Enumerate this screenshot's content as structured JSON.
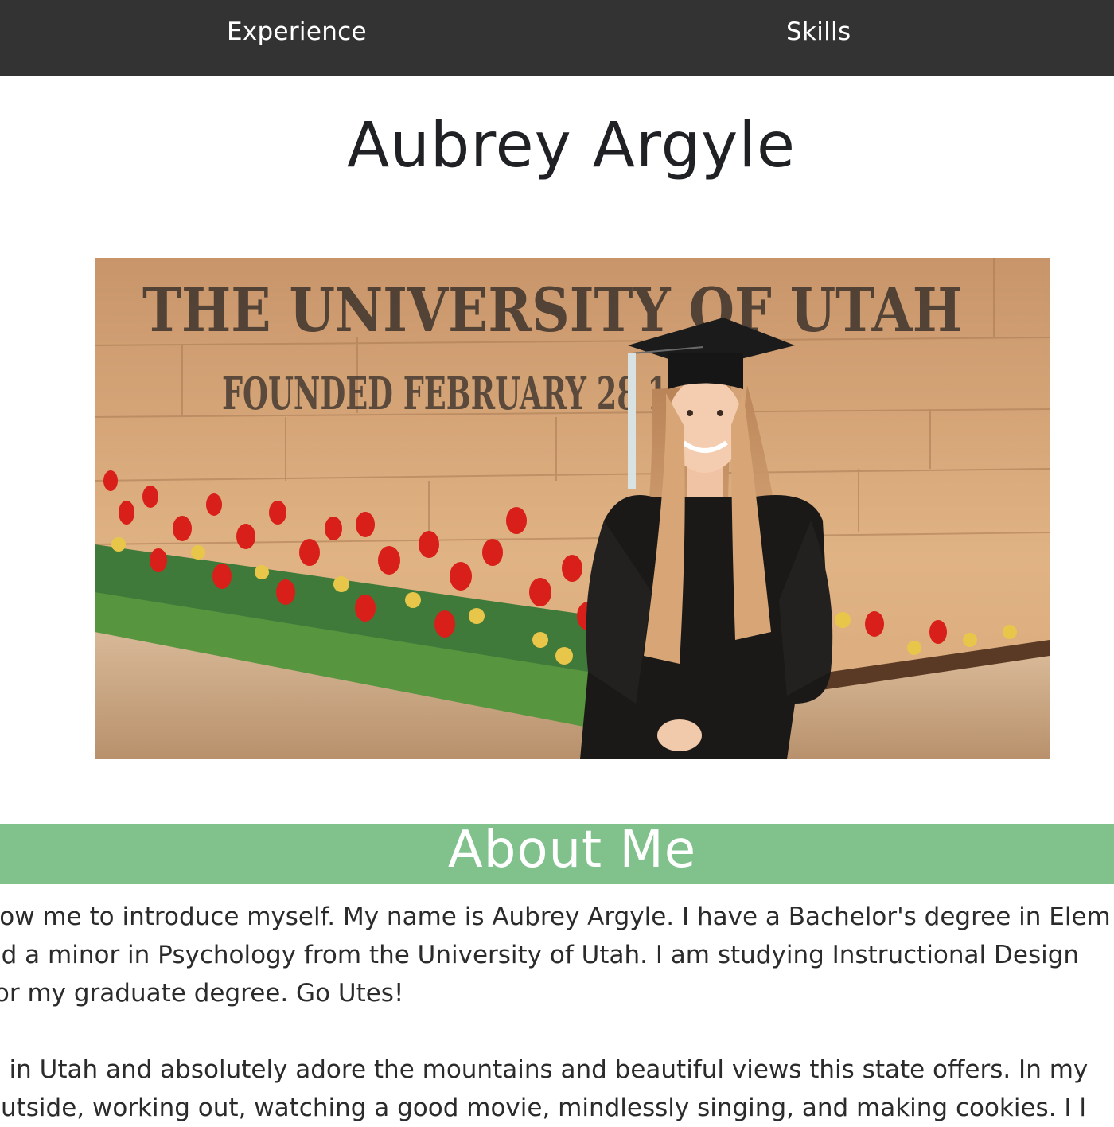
{
  "nav": {
    "experience": "Experience",
    "skills": "Skills"
  },
  "header": {
    "title": "Aubrey Argyle"
  },
  "hero": {
    "sign_line1": "THE UNIVERSITY OF UTAH",
    "sign_line2": "FOUNDED FEBRUARY 28 1"
  },
  "about": {
    "title": "About Me",
    "paragraph1": [
      "llow me to introduce myself. My name is Aubrey Argyle. I have a Bachelor's degree in Elem",
      "nd a minor in Psychology from the University of Utah. I am studying Instructional Design",
      "for my graduate degree. Go Utes!"
    ],
    "paragraph2": [
      "p in Utah and absolutely adore the mountains and beautiful views this state offers. In my",
      "outside, working out, watching a good movie, mindlessly singing, and making cookies. I l"
    ]
  },
  "colors": {
    "nav_bg": "#333333",
    "about_banner": "#80c18c"
  }
}
